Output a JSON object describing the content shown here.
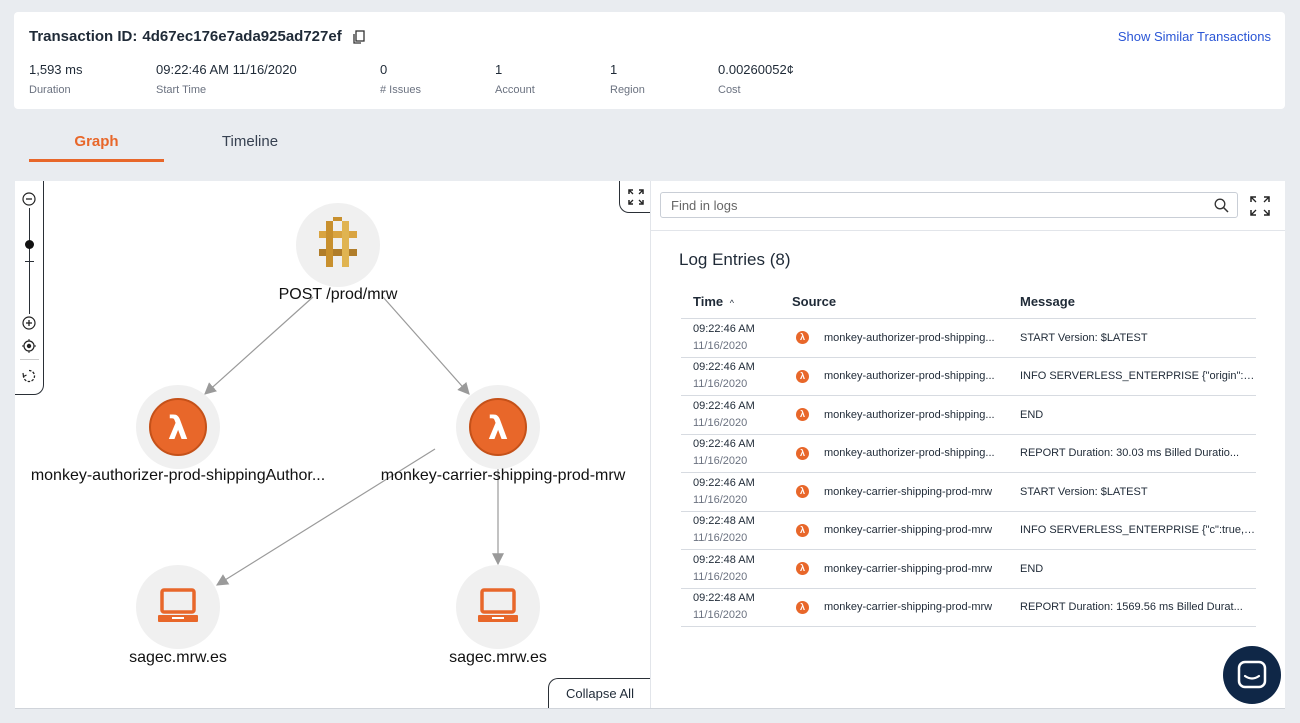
{
  "header": {
    "title_label": "Transaction ID:",
    "transaction_id": "4d67ec176e7ada925ad727ef",
    "similar_link": "Show Similar Transactions",
    "stats": [
      {
        "value": "1,593 ms",
        "label": "Duration"
      },
      {
        "value": "09:22:46 AM 11/16/2020",
        "label": "Start Time"
      },
      {
        "value": "0",
        "label": "# Issues"
      },
      {
        "value": "1",
        "label": "Account"
      },
      {
        "value": "1",
        "label": "Region"
      },
      {
        "value": "0.00260052¢",
        "label": "Cost"
      }
    ]
  },
  "tabs": [
    {
      "label": "Graph",
      "active": true
    },
    {
      "label": "Timeline",
      "active": false
    }
  ],
  "graph": {
    "nodes": [
      {
        "label": "POST /prod/mrw",
        "icon": "api-gateway-icon"
      },
      {
        "label": "monkey-authorizer-prod-shippingAuthor...",
        "icon": "lambda-icon"
      },
      {
        "label": "monkey-carrier-shipping-prod-mrw",
        "icon": "lambda-icon"
      },
      {
        "label": "sagec.mrw.es",
        "icon": "laptop-icon"
      },
      {
        "label": "sagec.mrw.es",
        "icon": "laptop-icon"
      }
    ],
    "collapse_label": "Collapse All"
  },
  "logs": {
    "search_placeholder": "Find in logs",
    "title": "Log Entries (8)",
    "columns": {
      "time": "Time",
      "source": "Source",
      "message": "Message"
    },
    "sort_indicator": "^",
    "entries": [
      {
        "time": "09:22:46 AM",
        "date": "11/16/2020",
        "source": "monkey-authorizer-prod-shipping...",
        "message": "START Version: $LATEST"
      },
      {
        "time": "09:22:46 AM",
        "date": "11/16/2020",
        "source": "monkey-authorizer-prod-shipping...",
        "message": "INFO SERVERLESS_ENTERPRISE {\"origin\":\"..."
      },
      {
        "time": "09:22:46 AM",
        "date": "11/16/2020",
        "source": "monkey-authorizer-prod-shipping...",
        "message": "END"
      },
      {
        "time": "09:22:46 AM",
        "date": "11/16/2020",
        "source": "monkey-authorizer-prod-shipping...",
        "message": "REPORT Duration: 30.03 ms Billed Duratio..."
      },
      {
        "time": "09:22:46 AM",
        "date": "11/16/2020",
        "source": "monkey-carrier-shipping-prod-mrw",
        "message": "START Version: $LATEST"
      },
      {
        "time": "09:22:48 AM",
        "date": "11/16/2020",
        "source": "monkey-carrier-shipping-prod-mrw",
        "message": "INFO SERVERLESS_ENTERPRISE {\"c\":true,\"..."
      },
      {
        "time": "09:22:48 AM",
        "date": "11/16/2020",
        "source": "monkey-carrier-shipping-prod-mrw",
        "message": "END"
      },
      {
        "time": "09:22:48 AM",
        "date": "11/16/2020",
        "source": "monkey-carrier-shipping-prod-mrw",
        "message": "REPORT Duration: 1569.56 ms Billed Durat..."
      }
    ]
  },
  "colors": {
    "accent": "#e8672a",
    "link": "#2a56d6",
    "chat": "#0f2747"
  }
}
